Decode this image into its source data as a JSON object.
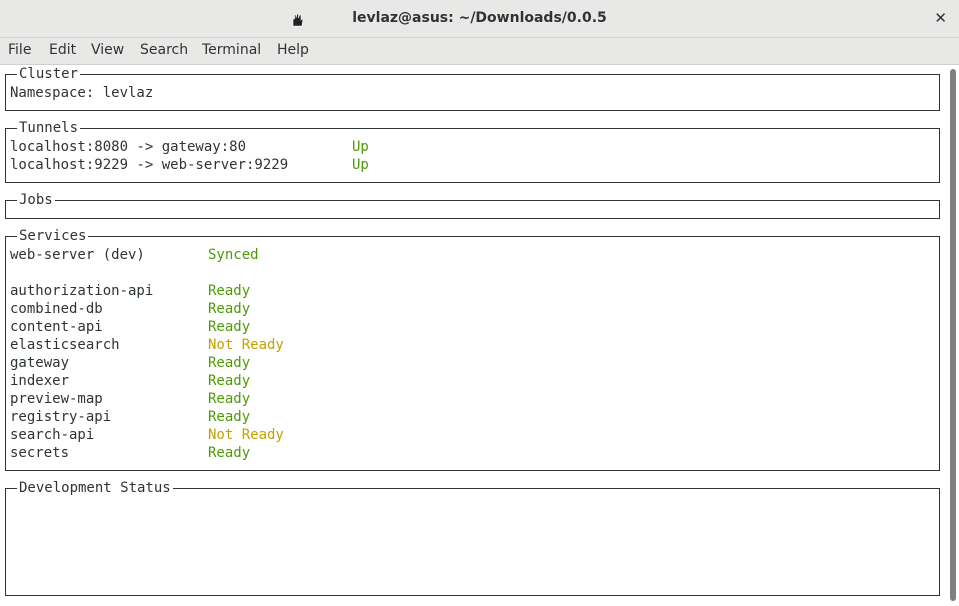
{
  "window": {
    "title": "levlaz@asus: ~/Downloads/0.0.5",
    "close_glyph": "✕"
  },
  "menu": [
    "File",
    "Edit",
    "View",
    "Search",
    "Terminal",
    "Help"
  ],
  "colors": {
    "ok": "#4e9a06",
    "warn": "#c4a000",
    "text": "#2e3436"
  },
  "cluster": {
    "title": "Cluster",
    "namespace_line": "Namespace: levlaz"
  },
  "tunnels": {
    "title": "Tunnels",
    "rows": [
      {
        "route": "localhost:8080 -> gateway:80",
        "status": "Up"
      },
      {
        "route": "localhost:9229 -> web-server:9229",
        "status": "Up"
      }
    ]
  },
  "jobs": {
    "title": "Jobs"
  },
  "services": {
    "title": "Services",
    "dev": {
      "name": "web-server (dev)",
      "status": "Synced"
    },
    "rows": [
      {
        "name": "authorization-api",
        "status": "Ready"
      },
      {
        "name": "combined-db",
        "status": "Ready"
      },
      {
        "name": "content-api",
        "status": "Ready"
      },
      {
        "name": "elasticsearch",
        "status": "Not Ready"
      },
      {
        "name": "gateway",
        "status": "Ready"
      },
      {
        "name": "indexer",
        "status": "Ready"
      },
      {
        "name": "preview-map",
        "status": "Ready"
      },
      {
        "name": "registry-api",
        "status": "Ready"
      },
      {
        "name": "search-api",
        "status": "Not Ready"
      },
      {
        "name": "secrets",
        "status": "Ready"
      }
    ]
  },
  "development": {
    "title": "Development Status"
  }
}
